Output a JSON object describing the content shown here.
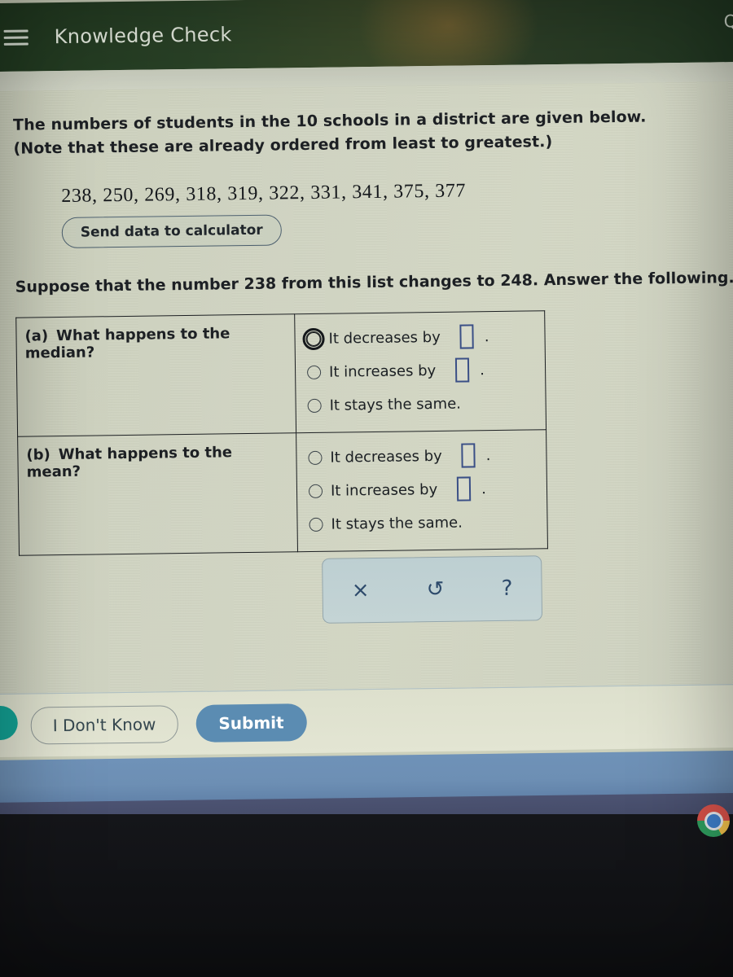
{
  "appbar": {
    "menu_icon": "hamburger-menu-icon",
    "title": "Knowledge Check",
    "right_label": "Qu"
  },
  "question": {
    "prompt_line1": "The numbers of students in the 10 schools in a district are given below.",
    "prompt_line2": "(Note that these are already ordered from least to greatest.)",
    "data_values": "238, 250, 269, 318, 319, 322, 331, 341, 375, 377",
    "send_to_calculator_label": "Send data to calculator",
    "suppose_text": "Suppose that the number 238 from this list changes to 248. Answer the following."
  },
  "parts": [
    {
      "number": "(a)",
      "label": "What happens to the median?",
      "options": [
        {
          "text": "It decreases by",
          "has_input": true,
          "input_value": "",
          "focused": true,
          "trailing": "."
        },
        {
          "text": "It increases by",
          "has_input": true,
          "input_value": "",
          "focused": false,
          "trailing": "."
        },
        {
          "text": "It stays the same.",
          "has_input": false,
          "input_value": "",
          "focused": false,
          "trailing": ""
        }
      ]
    },
    {
      "number": "(b)",
      "label": "What happens to the mean?",
      "options": [
        {
          "text": "It decreases by",
          "has_input": true,
          "input_value": "",
          "focused": false,
          "trailing": "."
        },
        {
          "text": "It increases by",
          "has_input": true,
          "input_value": "",
          "focused": false,
          "trailing": "."
        },
        {
          "text": "It stays the same.",
          "has_input": false,
          "input_value": "",
          "focused": false,
          "trailing": ""
        }
      ]
    }
  ],
  "toolbar": {
    "clear_icon": "×",
    "undo_icon": "↺",
    "help_icon": "?"
  },
  "actions": {
    "dont_know_label": "I Don't Know",
    "submit_label": "Submit"
  },
  "taskbar": {
    "chrome_icon": "chrome-browser-icon"
  },
  "colors": {
    "appbar_green": "#2a4227",
    "page_background": "#d2d6c4",
    "submit_blue": "#5b8cb2",
    "input_border_blue": "#3a4f86",
    "accent_teal": "#13a295"
  }
}
